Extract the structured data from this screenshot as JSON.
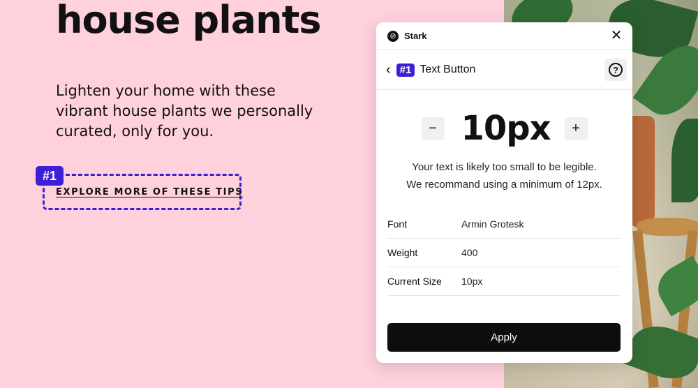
{
  "hero": {
    "title": "house plants",
    "description": "Lighten your home with these vibrant house plants we personally curated, only for you.",
    "link_label": "EXPLORE MORE OF THESE TIPS",
    "highlight_badge": "#1"
  },
  "panel": {
    "app_name": "Stark",
    "issue_badge": "#1",
    "issue_title": "Text Button",
    "size_value": "10px",
    "warning_line1": "Your text is likely too small to be legible.",
    "warning_line2": "We recommand using a minimum of 12px.",
    "properties": [
      {
        "label": "Font",
        "value": "Armin Grotesk"
      },
      {
        "label": "Weight",
        "value": "400"
      },
      {
        "label": "Current Size",
        "value": "10px"
      }
    ],
    "apply_label": "Apply"
  },
  "icons": {
    "close": "close-icon",
    "back": "chevron-left-icon",
    "help": "question-circle-icon",
    "minus": "minus-icon",
    "plus": "plus-icon"
  },
  "colors": {
    "background": "#ffd1dc",
    "accent": "#3d1fd6",
    "button": "#0d0d0d"
  }
}
